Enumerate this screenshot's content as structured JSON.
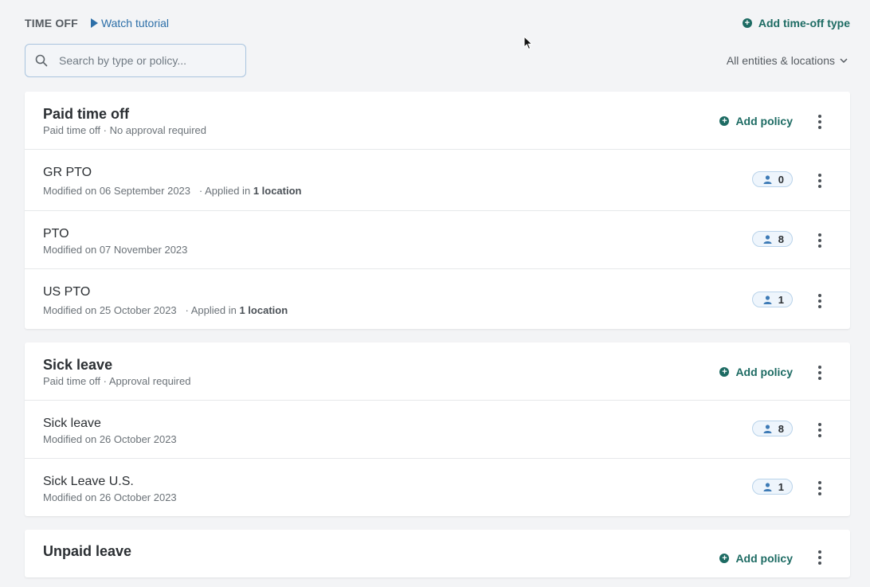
{
  "header": {
    "section_title": "TIME OFF",
    "tutorial_label": "Watch tutorial",
    "add_type_label": "Add time-off type"
  },
  "search": {
    "placeholder": "Search by type or policy...",
    "value": ""
  },
  "filter": {
    "label": "All entities & locations"
  },
  "groups": [
    {
      "title": "Paid time off",
      "subtitle": "Paid time off · No approval required",
      "add_policy_label": "Add policy",
      "policies": [
        {
          "name": "GR PTO",
          "modified": "Modified on 06 September 2023",
          "applied_prefix": "·  Applied in",
          "applied_value": "1 location",
          "count": "0"
        },
        {
          "name": "PTO",
          "modified": "Modified on 07 November 2023",
          "count": "8"
        },
        {
          "name": "US PTO",
          "modified": "Modified on 25 October 2023",
          "applied_prefix": "·  Applied in",
          "applied_value": "1 location",
          "count": "1"
        }
      ]
    },
    {
      "title": "Sick leave",
      "subtitle": "Paid time off · Approval required",
      "add_policy_label": "Add policy",
      "policies": [
        {
          "name": "Sick leave",
          "modified": "Modified on 26 October 2023",
          "count": "8"
        },
        {
          "name": "Sick Leave U.S.",
          "modified": "Modified on 26 October 2023",
          "count": "1"
        }
      ]
    },
    {
      "title": "Unpaid leave",
      "add_policy_label": "Add policy"
    }
  ],
  "icons": {
    "play": "play-icon",
    "plus": "plus-circle-icon",
    "search": "search-icon",
    "chevron": "chevron-down-icon",
    "more": "more-vertical-icon",
    "user": "user-icon"
  },
  "colors": {
    "accent_green": "#1d6b63",
    "link_blue": "#2d6fa8",
    "badge_bg": "#eef5fc"
  }
}
